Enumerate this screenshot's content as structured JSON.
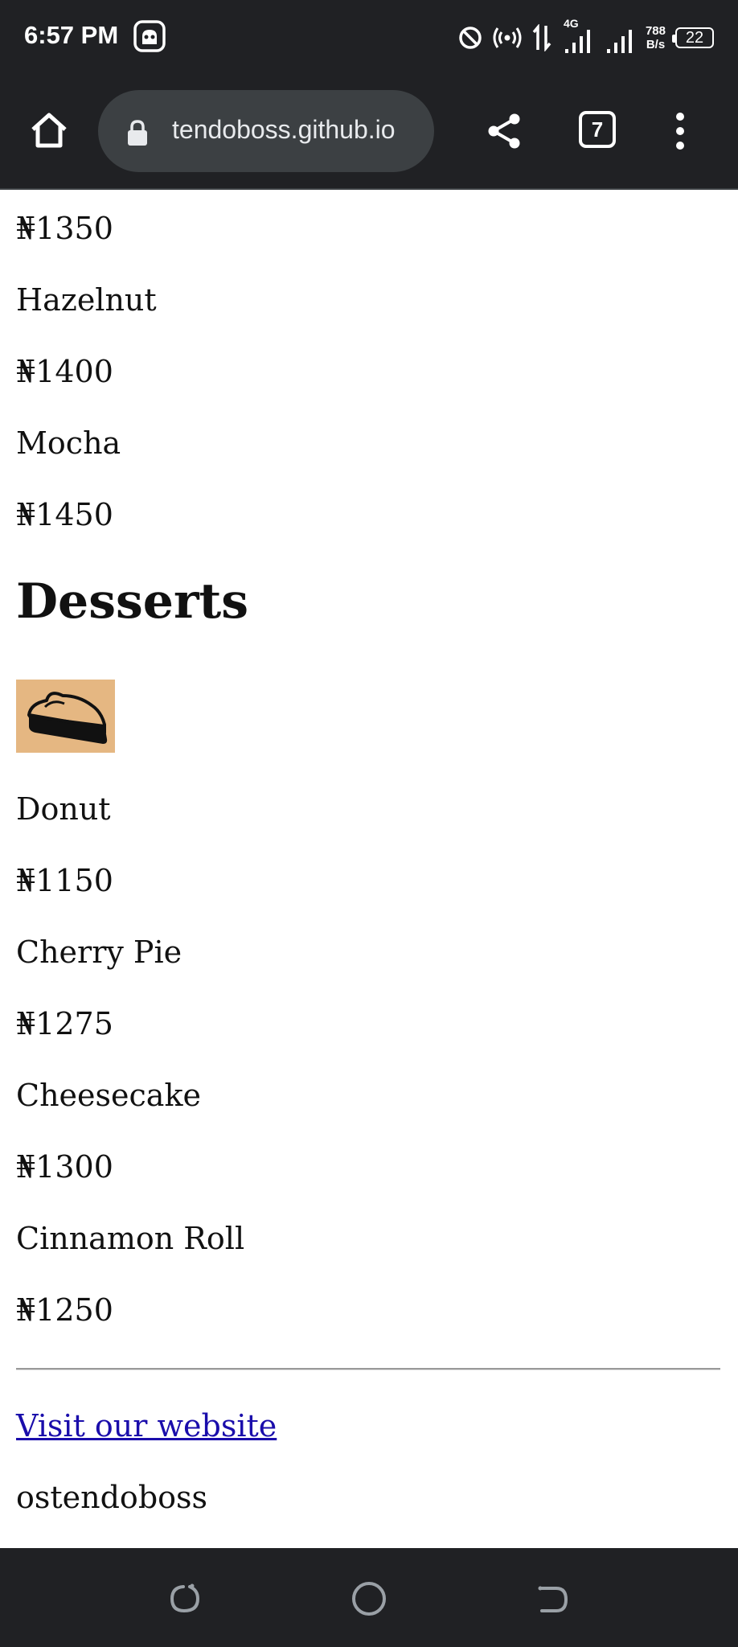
{
  "status_bar": {
    "time": "6:57 PM",
    "network_type": "4G",
    "speed_value": "788",
    "speed_unit": "B/s",
    "battery": "22",
    "icons": [
      "app-notification-icon",
      "do-not-disturb-icon",
      "hotspot-icon",
      "data-transfer-icon",
      "signal-icon",
      "signal-icon",
      "battery-icon"
    ]
  },
  "browser": {
    "url": "tendoboss.github.io",
    "tab_count": "7",
    "icons": [
      "home-icon",
      "lock-icon",
      "share-icon",
      "tab-switcher-icon",
      "more-vert-icon"
    ]
  },
  "page": {
    "items_top": [
      {
        "text": "₦1350"
      },
      {
        "text": "Hazelnut"
      },
      {
        "text": "₦1400"
      },
      {
        "text": "Mocha"
      },
      {
        "text": "₦1450"
      }
    ],
    "desserts_heading": "Desserts",
    "pie_image": "pie-slice-image",
    "dessert_items": [
      {
        "name": "Donut",
        "price": "₦1150"
      },
      {
        "name": "Cherry Pie",
        "price": "₦1275"
      },
      {
        "name": "Cheesecake",
        "price": "₦1300"
      },
      {
        "name": "Cinnamon Roll",
        "price": "₦1250"
      }
    ],
    "footer": {
      "link_text": "Visit our website",
      "author": "ostendoboss"
    }
  },
  "nav_bar": {
    "icons": [
      "recents-icon",
      "home-circle-icon",
      "back-icon"
    ]
  },
  "colors": {
    "chrome_bg": "#202124",
    "omnibox_bg": "#3c4043",
    "link": "#1a0dab",
    "image_bg": "#e5b782"
  }
}
